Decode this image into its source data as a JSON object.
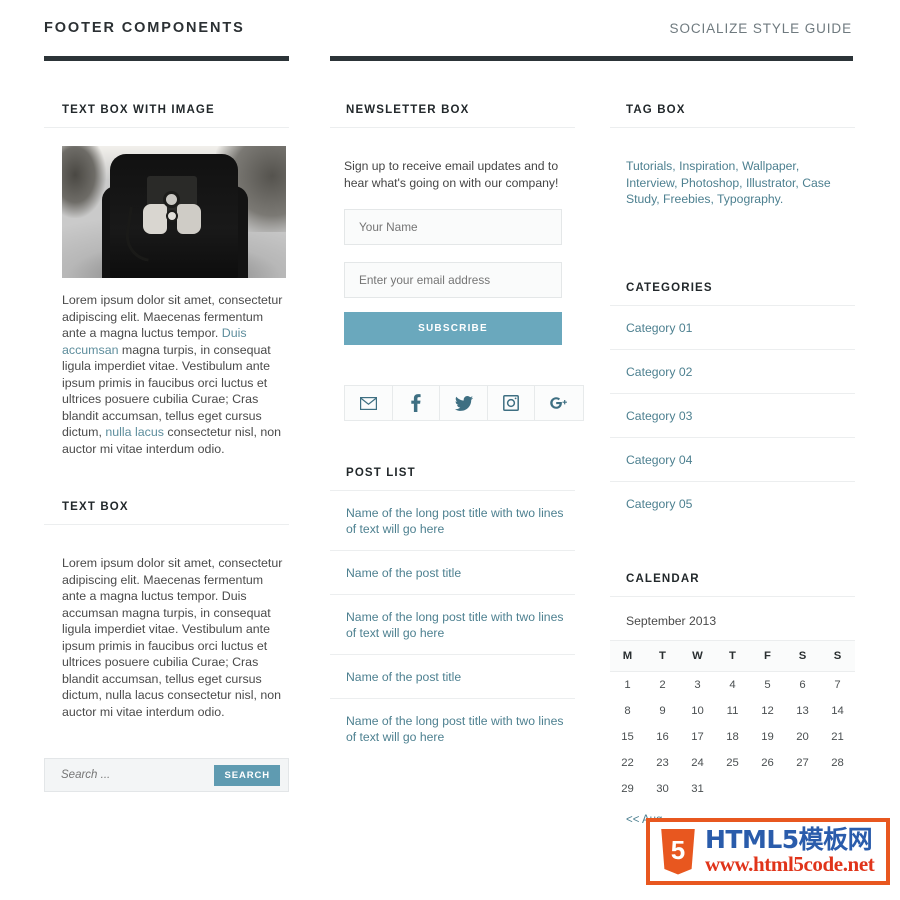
{
  "header": {
    "title": "FOOTER COMPONENTS",
    "subtitle": "SOCIALIZE STYLE GUIDE"
  },
  "colors": {
    "accent_teal": "#6aa8bd",
    "link_teal": "#4d8090",
    "rule_dark": "#2c3438",
    "search_button": "#5f9bb1",
    "watermark_orange": "#e8571f",
    "watermark_blue": "#2a5cab",
    "watermark_red": "#e0341a"
  },
  "left_column": {
    "text_box_with_image": {
      "title": "TEXT BOX WITH IMAGE",
      "image_alt": "black and white photo of person holding a vintage camera",
      "paragraph_parts": [
        {
          "text": "Lorem ipsum dolor sit amet, consectetur adipiscing elit. Maecenas fermentum ante a magna luctus tempor. ",
          "link": false
        },
        {
          "text": "Duis accumsan",
          "link": true
        },
        {
          "text": " magna turpis, in consequat ligula imperdiet vitae. Vestibulum ante ipsum primis in faucibus orci luctus et ultrices posuere cubilia Curae; Cras blandit accumsan, tellus eget cursus dictum, ",
          "link": false
        },
        {
          "text": "nulla lacus",
          "link": true
        },
        {
          "text": " consectetur nisl, non auctor mi vitae interdum odio.",
          "link": false
        }
      ]
    },
    "text_box": {
      "title": "TEXT BOX",
      "paragraph": "Lorem ipsum dolor sit amet, consectetur adipiscing elit. Maecenas fermentum ante a magna luctus tempor. Duis accumsan magna turpis, in consequat ligula imperdiet vitae. Vestibulum ante ipsum primis in faucibus orci luctus et ultrices posuere cubilia Curae; Cras blandit accumsan, tellus eget cursus dictum, nulla lacus consectetur nisl, non auctor mi vitae interdum odio."
    },
    "search": {
      "placeholder": "Search ...",
      "value": "",
      "button_label": "SEARCH"
    }
  },
  "middle_column": {
    "newsletter": {
      "title": "NEWSLETTER BOX",
      "description": "Sign up to receive email updates and to hear what's going on with our company!",
      "name_placeholder": "Your Name",
      "name_value": "",
      "email_placeholder": "Enter your email address",
      "email_value": "",
      "button_label": "SUBSCRIBE"
    },
    "social_icons": [
      {
        "name": "mail-icon",
        "label": "Email"
      },
      {
        "name": "facebook-icon",
        "label": "Facebook"
      },
      {
        "name": "twitter-icon",
        "label": "Twitter"
      },
      {
        "name": "instagram-icon",
        "label": "Instagram"
      },
      {
        "name": "googleplus-icon",
        "label": "Google Plus"
      }
    ],
    "post_list": {
      "title": "POST LIST",
      "items": [
        "Name of the long post title with two lines of text will go here",
        "Name of the post title",
        "Name of the long post title with two lines of text will go here",
        "Name of the post title",
        "Name of the long post title with two lines of text will go here"
      ]
    }
  },
  "right_column": {
    "tag_box": {
      "title": "TAG BOX",
      "tags": [
        "Tutorials",
        "Inspiration",
        "Wallpaper",
        "Interview",
        "Photoshop",
        "Illustrator",
        "Case Study",
        "Freebies",
        "Typography"
      ],
      "separator": ", ",
      "terminator": "."
    },
    "categories": {
      "title": "CATEGORIES",
      "items": [
        "Category 01",
        "Category 02",
        "Category 03",
        "Category 04",
        "Category 05"
      ]
    },
    "calendar": {
      "title": "CALENDAR",
      "month_label": "September 2013",
      "weekday_headers": [
        "M",
        "T",
        "W",
        "T",
        "F",
        "S",
        "S"
      ],
      "weeks": [
        [
          "1",
          "2",
          "3",
          "4",
          "5",
          "6",
          "7"
        ],
        [
          "8",
          "9",
          "10",
          "11",
          "12",
          "13",
          "14"
        ],
        [
          "15",
          "16",
          "17",
          "18",
          "19",
          "20",
          "21"
        ],
        [
          "22",
          "23",
          "24",
          "25",
          "26",
          "27",
          "28"
        ],
        [
          "29",
          "30",
          "31",
          "",
          "",
          "",
          ""
        ]
      ],
      "prev_link": "<< Aug"
    }
  },
  "watermark": {
    "shield_text": "5",
    "line1": "HTML5模板网",
    "line2": "www.html5code.net"
  }
}
